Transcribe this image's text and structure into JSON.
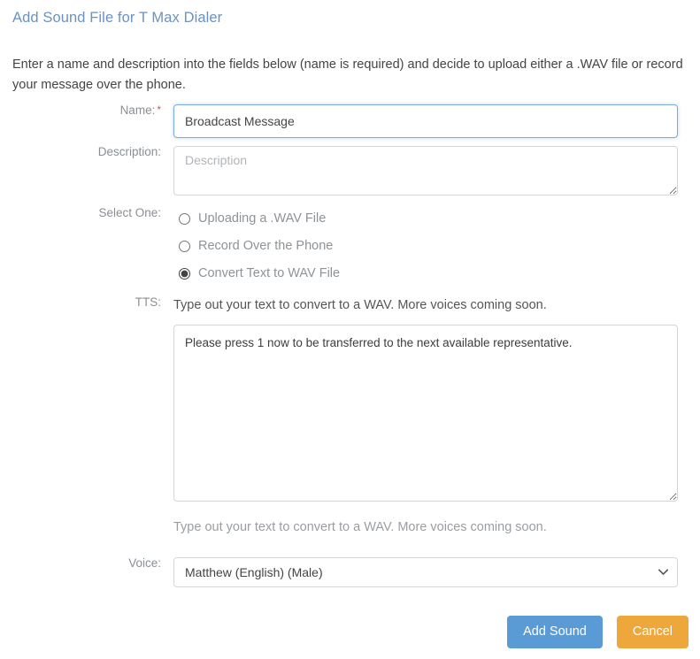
{
  "page": {
    "title": "Add Sound File for T Max Dialer",
    "intro": "Enter a name and description into the fields below (name is required) and decide to upload either a .WAV file or record your message over the phone."
  },
  "form": {
    "name": {
      "label": "Name:",
      "required_marker": "*",
      "value": "Broadcast Message"
    },
    "description": {
      "label": "Description:",
      "value": "",
      "placeholder": "Description"
    },
    "select_one": {
      "label": "Select One:",
      "options": [
        {
          "label": "Uploading a .WAV File",
          "selected": false
        },
        {
          "label": "Record Over the Phone",
          "selected": false
        },
        {
          "label": "Convert Text to WAV File",
          "selected": true
        }
      ]
    },
    "tts": {
      "label": "TTS:",
      "hint_above": "Type out your text to convert to a WAV. More voices coming soon.",
      "value": "Please press 1 now to be transferred to the next available representative.",
      "hint_below": "Type out your text to convert to a WAV. More voices coming soon."
    },
    "voice": {
      "label": "Voice:",
      "selected": "Matthew (English) (Male)",
      "options": [
        "Matthew (English) (Male)"
      ]
    }
  },
  "actions": {
    "submit_label": "Add Sound",
    "cancel_label": "Cancel"
  },
  "colors": {
    "title": "#6b92c4",
    "required": "#d9534f",
    "primary_button": "#5b9bd5",
    "cancel_button": "#eda73b",
    "focus_border": "#7aaddd"
  }
}
